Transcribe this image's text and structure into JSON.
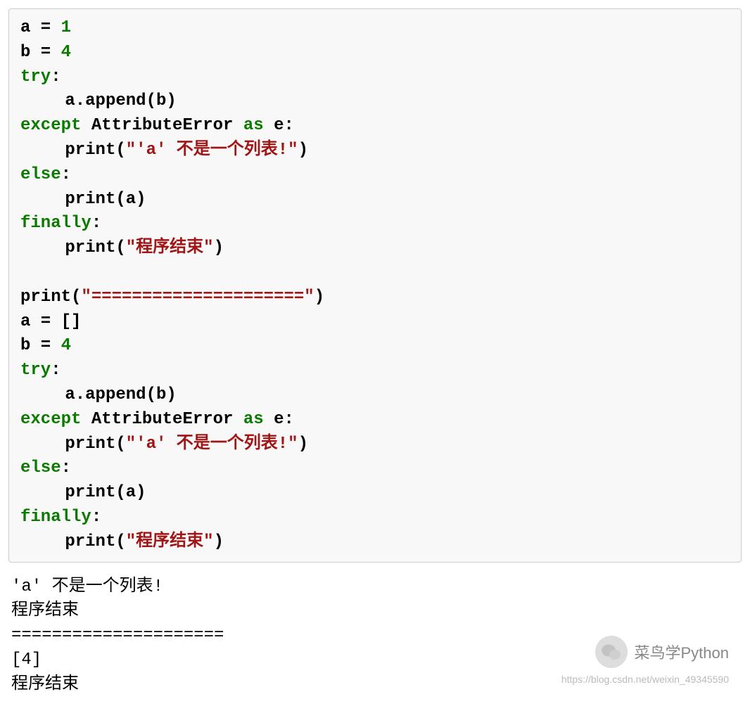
{
  "code": {
    "l1_a": "a",
    "l1_eq": " = ",
    "l1_v": "1",
    "l2_a": "b",
    "l2_eq": " = ",
    "l2_v": "4",
    "try": "try",
    "colon": ":",
    "append": "a.append(b)",
    "except": "except",
    "sp": " ",
    "attrerr": "AttributeError",
    "as": "as",
    "e": "e:",
    "print": "print",
    "paren_open": "(",
    "paren_close": ")",
    "str1": "\"'a' 不是一个列表!\"",
    "else": "else",
    "print_a": "a",
    "finally": "finally",
    "str_end": "\"程序结束\"",
    "sep_str": "\"=====================\"",
    "list_empty": "[]",
    "b2": "b",
    "b2_eq": " = ",
    "b2_v": "4"
  },
  "output": {
    "o1": "'a' 不是一个列表!",
    "o2": "程序结束",
    "o3": "=====================",
    "o4": "[4]",
    "o5": "程序结束"
  },
  "watermark": {
    "text": "菜鸟学Python",
    "url": "https://blog.csdn.net/weixin_49345590"
  }
}
